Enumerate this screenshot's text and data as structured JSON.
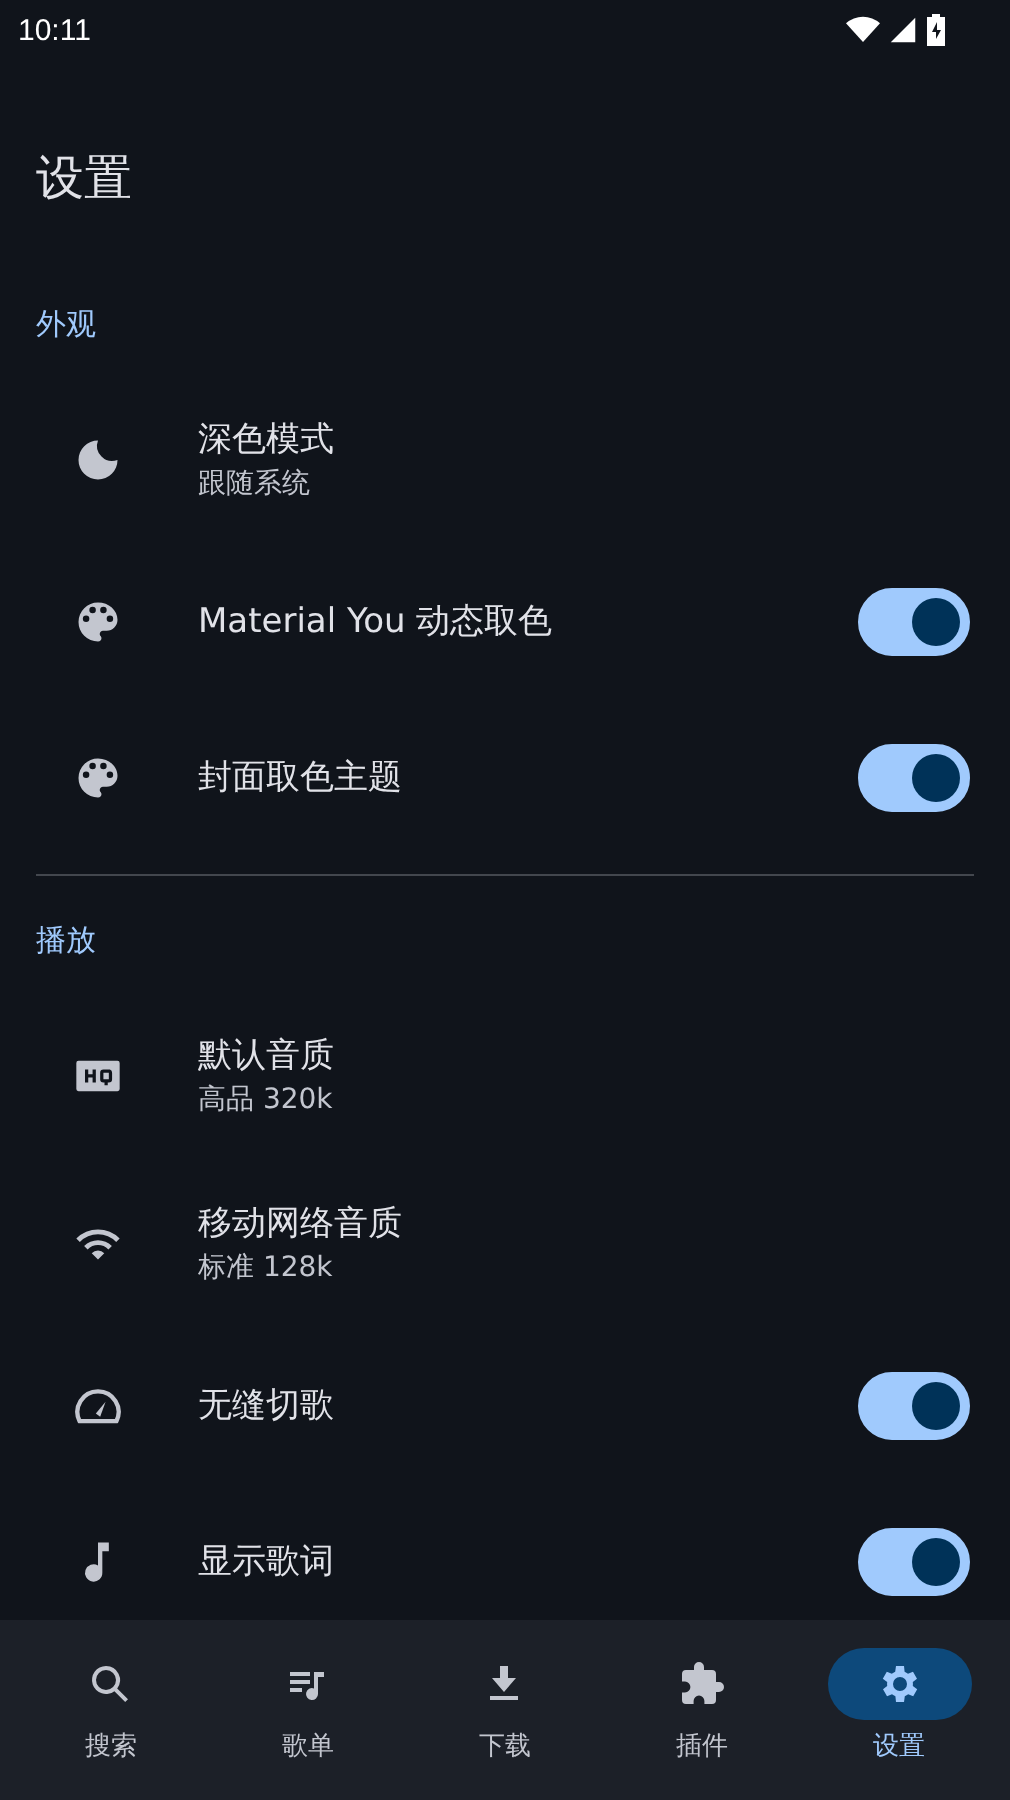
{
  "status_bar": {
    "time": "10:11"
  },
  "title": "设置",
  "sections": [
    {
      "header": "外观",
      "items": [
        {
          "kind": "value",
          "title": "深色模式",
          "value": "跟随系统"
        },
        {
          "kind": "switch",
          "title": "Material You 动态取色",
          "on": true
        },
        {
          "kind": "switch",
          "title": "封面取色主题",
          "on": true
        }
      ]
    },
    {
      "header": "播放",
      "items": [
        {
          "kind": "value",
          "title": "默认音质",
          "value": "高品 320k"
        },
        {
          "kind": "value",
          "title": "移动网络音质",
          "value": "标准 128k"
        },
        {
          "kind": "switch",
          "title": "无缝切歌",
          "on": true
        },
        {
          "kind": "switch",
          "title": "显示歌词",
          "on": true
        }
      ]
    }
  ],
  "nav": [
    {
      "label": "搜索",
      "selected": false
    },
    {
      "label": "歌单",
      "selected": false
    },
    {
      "label": "下载",
      "selected": false
    },
    {
      "label": "插件",
      "selected": false
    },
    {
      "label": "设置",
      "selected": true
    }
  ]
}
